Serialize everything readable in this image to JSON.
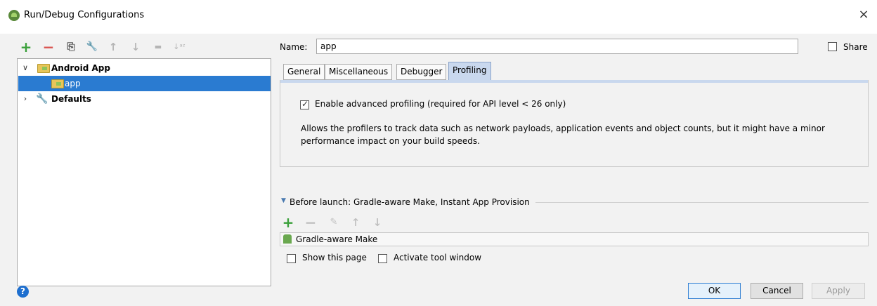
{
  "window": {
    "title": "Run/Debug Configurations",
    "close_glyph": "×"
  },
  "toolbar": {
    "add": "+",
    "remove": "−",
    "copy": "⎘",
    "edit_defaults": "🔧",
    "move_up": "↑",
    "move_down": "↓",
    "folder": "▬",
    "sort": "↓ᵃᶻ"
  },
  "tree": {
    "items": [
      {
        "label": "Android App",
        "expanded": true
      },
      {
        "label": "app",
        "selected": true
      },
      {
        "label": "Defaults",
        "expanded": false
      }
    ]
  },
  "form": {
    "name_label": "Name:",
    "name_value": "app",
    "share_label": "Share",
    "share_checked": false
  },
  "tabs": [
    {
      "label": "General"
    },
    {
      "label": "Miscellaneous"
    },
    {
      "label": "Debugger"
    },
    {
      "label": "Profiling",
      "active": true
    }
  ],
  "profiling": {
    "enable_label": "Enable advanced profiling (required for API level < 26 only)",
    "enable_checked": true,
    "description": "Allows the profilers to track data such as network payloads, application events and object counts, but it might have a minor performance impact on your build speeds."
  },
  "before_launch": {
    "title": "Before launch: Gradle-aware Make, Instant App Provision",
    "items": [
      {
        "label": "Gradle-aware Make"
      }
    ],
    "show_page_label": "Show this page",
    "activate_label": "Activate tool window"
  },
  "buttons": {
    "ok": "OK",
    "cancel": "Cancel",
    "apply": "Apply"
  },
  "colors": {
    "selection": "#2a7bd1",
    "active_tab": "#c9d8ee",
    "add_green": "#3aa03a",
    "remove_red": "#d9534f"
  }
}
